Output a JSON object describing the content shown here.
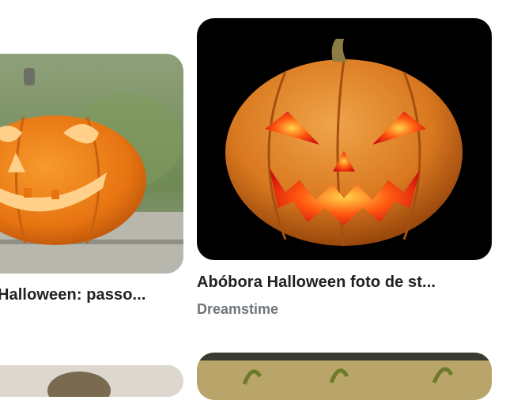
{
  "results": [
    {
      "title": "Halloween: passo...",
      "source": ""
    },
    {
      "title": "Abóbora Halloween foto de st...",
      "source": "Dreamstime"
    }
  ]
}
